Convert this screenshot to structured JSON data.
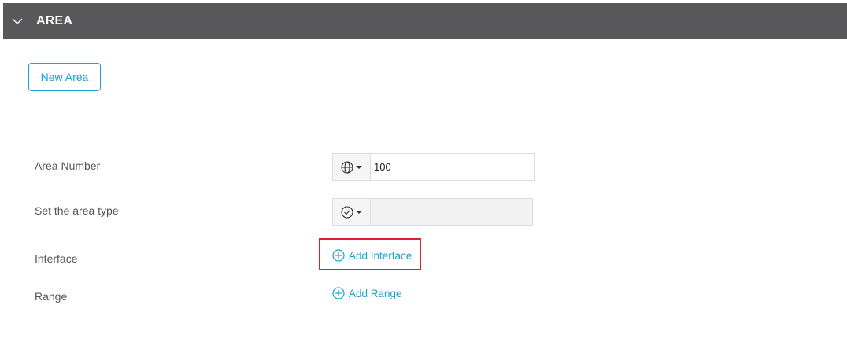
{
  "section": {
    "title": "AREA",
    "collapse_icon": "chevron-down-icon"
  },
  "buttons": {
    "new_area": "New Area"
  },
  "form": {
    "area_number": {
      "label": "Area Number",
      "icon": "globe-icon",
      "value": "100"
    },
    "area_type": {
      "label": "Set the area type",
      "icon": "check-circle-icon",
      "value": ""
    },
    "interface": {
      "label": "Interface",
      "action_label": "Add Interface",
      "icon": "plus-circle-icon"
    },
    "range": {
      "label": "Range",
      "action_label": "Add Range",
      "icon": "plus-circle-icon"
    }
  },
  "colors": {
    "header_bg": "#58585a",
    "accent": "#1f9ed1",
    "highlight": "#e0202a"
  }
}
